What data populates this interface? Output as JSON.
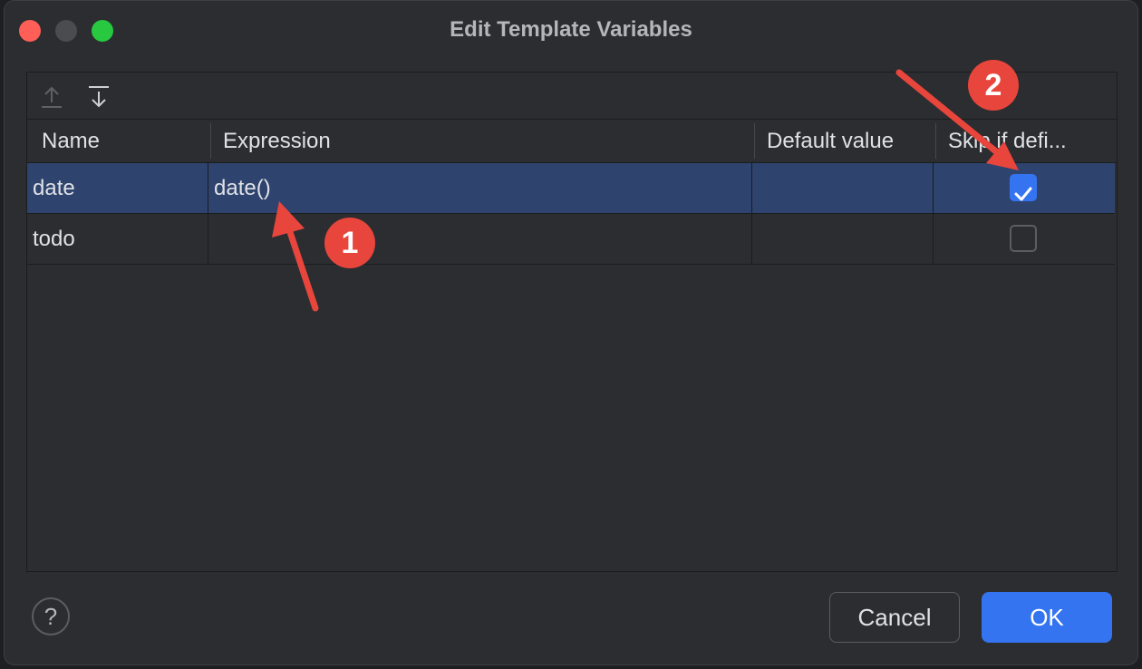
{
  "window": {
    "title": "Edit Template Variables"
  },
  "columns": [
    "Name",
    "Expression",
    "Default value",
    "Skip if defi..."
  ],
  "rows": [
    {
      "name": "date",
      "expression": "date()",
      "default_value": "",
      "skip_if_defined": true,
      "selected": true
    },
    {
      "name": "todo",
      "expression": "",
      "default_value": "",
      "skip_if_defined": false,
      "selected": false
    }
  ],
  "toolbar": {
    "move_up_icon": "arrow-up-icon",
    "move_down_icon": "arrow-down-icon"
  },
  "footer": {
    "help_label": "?",
    "cancel_label": "Cancel",
    "ok_label": "OK"
  },
  "annotations": {
    "marker_1": "1",
    "marker_2": "2"
  },
  "colors": {
    "accent": "#3574f0",
    "selection": "#2e436e",
    "annotation": "#e8453c"
  }
}
